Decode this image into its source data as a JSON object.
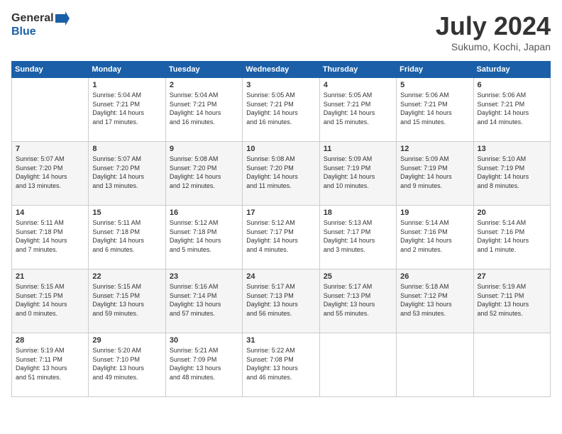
{
  "header": {
    "logo_line1": "General",
    "logo_line2": "Blue",
    "month": "July 2024",
    "location": "Sukumo, Kochi, Japan"
  },
  "days_of_week": [
    "Sunday",
    "Monday",
    "Tuesday",
    "Wednesday",
    "Thursday",
    "Friday",
    "Saturday"
  ],
  "weeks": [
    [
      {
        "day": "",
        "info": ""
      },
      {
        "day": "1",
        "info": "Sunrise: 5:04 AM\nSunset: 7:21 PM\nDaylight: 14 hours\nand 17 minutes."
      },
      {
        "day": "2",
        "info": "Sunrise: 5:04 AM\nSunset: 7:21 PM\nDaylight: 14 hours\nand 16 minutes."
      },
      {
        "day": "3",
        "info": "Sunrise: 5:05 AM\nSunset: 7:21 PM\nDaylight: 14 hours\nand 16 minutes."
      },
      {
        "day": "4",
        "info": "Sunrise: 5:05 AM\nSunset: 7:21 PM\nDaylight: 14 hours\nand 15 minutes."
      },
      {
        "day": "5",
        "info": "Sunrise: 5:06 AM\nSunset: 7:21 PM\nDaylight: 14 hours\nand 15 minutes."
      },
      {
        "day": "6",
        "info": "Sunrise: 5:06 AM\nSunset: 7:21 PM\nDaylight: 14 hours\nand 14 minutes."
      }
    ],
    [
      {
        "day": "7",
        "info": "Sunrise: 5:07 AM\nSunset: 7:20 PM\nDaylight: 14 hours\nand 13 minutes."
      },
      {
        "day": "8",
        "info": "Sunrise: 5:07 AM\nSunset: 7:20 PM\nDaylight: 14 hours\nand 13 minutes."
      },
      {
        "day": "9",
        "info": "Sunrise: 5:08 AM\nSunset: 7:20 PM\nDaylight: 14 hours\nand 12 minutes."
      },
      {
        "day": "10",
        "info": "Sunrise: 5:08 AM\nSunset: 7:20 PM\nDaylight: 14 hours\nand 11 minutes."
      },
      {
        "day": "11",
        "info": "Sunrise: 5:09 AM\nSunset: 7:19 PM\nDaylight: 14 hours\nand 10 minutes."
      },
      {
        "day": "12",
        "info": "Sunrise: 5:09 AM\nSunset: 7:19 PM\nDaylight: 14 hours\nand 9 minutes."
      },
      {
        "day": "13",
        "info": "Sunrise: 5:10 AM\nSunset: 7:19 PM\nDaylight: 14 hours\nand 8 minutes."
      }
    ],
    [
      {
        "day": "14",
        "info": "Sunrise: 5:11 AM\nSunset: 7:18 PM\nDaylight: 14 hours\nand 7 minutes."
      },
      {
        "day": "15",
        "info": "Sunrise: 5:11 AM\nSunset: 7:18 PM\nDaylight: 14 hours\nand 6 minutes."
      },
      {
        "day": "16",
        "info": "Sunrise: 5:12 AM\nSunset: 7:18 PM\nDaylight: 14 hours\nand 5 minutes."
      },
      {
        "day": "17",
        "info": "Sunrise: 5:12 AM\nSunset: 7:17 PM\nDaylight: 14 hours\nand 4 minutes."
      },
      {
        "day": "18",
        "info": "Sunrise: 5:13 AM\nSunset: 7:17 PM\nDaylight: 14 hours\nand 3 minutes."
      },
      {
        "day": "19",
        "info": "Sunrise: 5:14 AM\nSunset: 7:16 PM\nDaylight: 14 hours\nand 2 minutes."
      },
      {
        "day": "20",
        "info": "Sunrise: 5:14 AM\nSunset: 7:16 PM\nDaylight: 14 hours\nand 1 minute."
      }
    ],
    [
      {
        "day": "21",
        "info": "Sunrise: 5:15 AM\nSunset: 7:15 PM\nDaylight: 14 hours\nand 0 minutes."
      },
      {
        "day": "22",
        "info": "Sunrise: 5:15 AM\nSunset: 7:15 PM\nDaylight: 13 hours\nand 59 minutes."
      },
      {
        "day": "23",
        "info": "Sunrise: 5:16 AM\nSunset: 7:14 PM\nDaylight: 13 hours\nand 57 minutes."
      },
      {
        "day": "24",
        "info": "Sunrise: 5:17 AM\nSunset: 7:13 PM\nDaylight: 13 hours\nand 56 minutes."
      },
      {
        "day": "25",
        "info": "Sunrise: 5:17 AM\nSunset: 7:13 PM\nDaylight: 13 hours\nand 55 minutes."
      },
      {
        "day": "26",
        "info": "Sunrise: 5:18 AM\nSunset: 7:12 PM\nDaylight: 13 hours\nand 53 minutes."
      },
      {
        "day": "27",
        "info": "Sunrise: 5:19 AM\nSunset: 7:11 PM\nDaylight: 13 hours\nand 52 minutes."
      }
    ],
    [
      {
        "day": "28",
        "info": "Sunrise: 5:19 AM\nSunset: 7:11 PM\nDaylight: 13 hours\nand 51 minutes."
      },
      {
        "day": "29",
        "info": "Sunrise: 5:20 AM\nSunset: 7:10 PM\nDaylight: 13 hours\nand 49 minutes."
      },
      {
        "day": "30",
        "info": "Sunrise: 5:21 AM\nSunset: 7:09 PM\nDaylight: 13 hours\nand 48 minutes."
      },
      {
        "day": "31",
        "info": "Sunrise: 5:22 AM\nSunset: 7:08 PM\nDaylight: 13 hours\nand 46 minutes."
      },
      {
        "day": "",
        "info": ""
      },
      {
        "day": "",
        "info": ""
      },
      {
        "day": "",
        "info": ""
      }
    ]
  ]
}
